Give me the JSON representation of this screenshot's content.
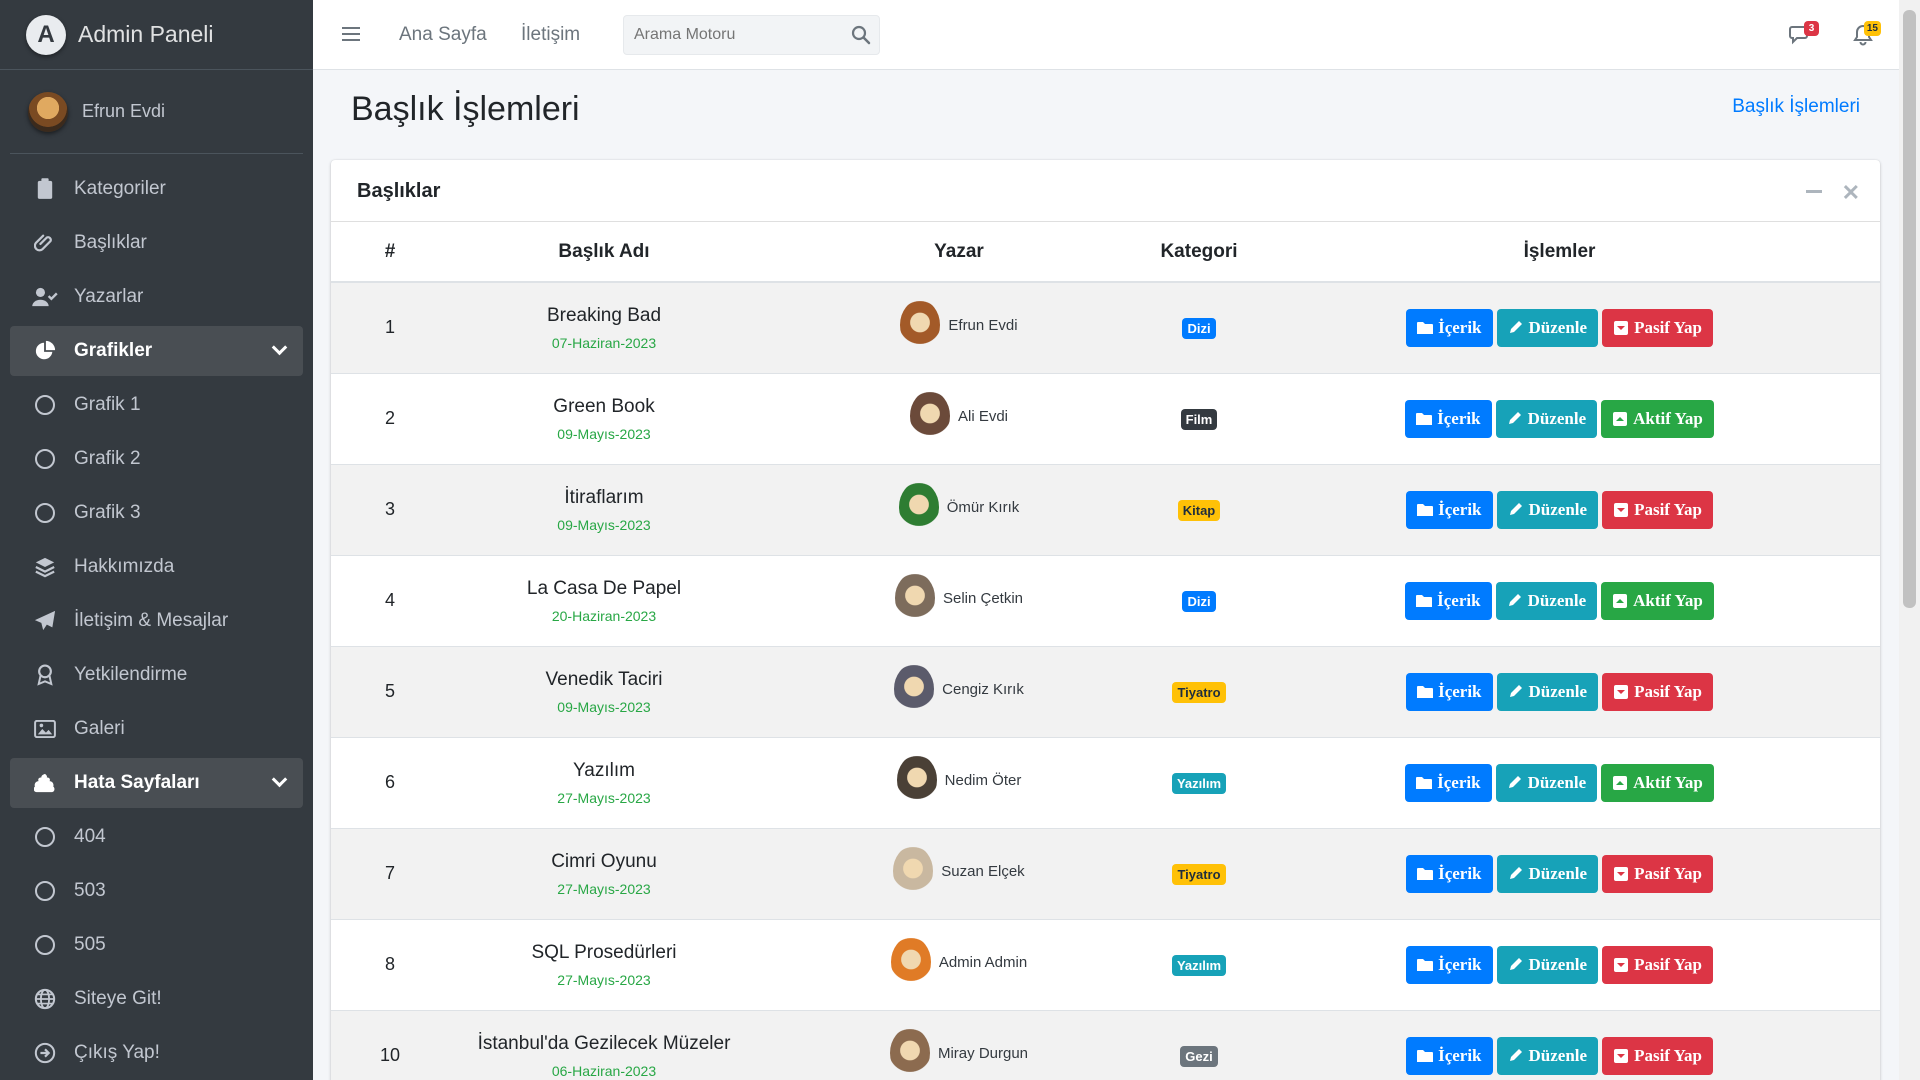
{
  "brand": {
    "title": "Admin Paneli",
    "logo_letter": "A"
  },
  "user": {
    "name": "Efrun Evdi"
  },
  "sidebar": {
    "items": [
      {
        "label": "Kategoriler",
        "icon": "clipboard-icon",
        "open": false
      },
      {
        "label": "Başlıklar",
        "icon": "paperclip-icon",
        "open": false
      },
      {
        "label": "Yazarlar",
        "icon": "user-check-icon",
        "open": false
      },
      {
        "label": "Grafikler",
        "icon": "chart-pie-icon",
        "open": true
      },
      {
        "label": "Grafik 1",
        "icon": "circle-icon",
        "sub": true
      },
      {
        "label": "Grafik 2",
        "icon": "circle-icon",
        "sub": true
      },
      {
        "label": "Grafik 3",
        "icon": "circle-icon",
        "sub": true
      },
      {
        "label": "Hakkımızda",
        "icon": "layers-icon",
        "open": false
      },
      {
        "label": "İletişim & Mesajlar",
        "icon": "paper-plane-icon",
        "open": false
      },
      {
        "label": "Yetkilendirme",
        "icon": "award-icon",
        "open": false
      },
      {
        "label": "Galeri",
        "icon": "image-icon",
        "open": false
      },
      {
        "label": "Hata Sayfaları",
        "icon": "poo-icon",
        "open": true
      },
      {
        "label": "404",
        "icon": "circle-icon",
        "sub": true
      },
      {
        "label": "503",
        "icon": "circle-icon",
        "sub": true
      },
      {
        "label": "505",
        "icon": "circle-icon",
        "sub": true
      },
      {
        "label": "Siteye Git!",
        "icon": "globe-icon",
        "open": false
      },
      {
        "label": "Çıkış Yap!",
        "icon": "sign-out-icon",
        "open": false
      }
    ]
  },
  "topbar": {
    "links": [
      "Ana Sayfa",
      "İletişim"
    ],
    "search_placeholder": "Arama Motoru",
    "messages_count": "3",
    "notifications_count": "15"
  },
  "page": {
    "title": "Başlık İşlemleri",
    "breadcrumb": "Başlık İşlemleri"
  },
  "card": {
    "title": "Başlıklar"
  },
  "table": {
    "headers": [
      "#",
      "Başlık Adı",
      "Yazar",
      "Kategori",
      "İşlemler"
    ],
    "rows": [
      {
        "num": "1",
        "title": "Breaking Bad",
        "date": "07-Haziran-2023",
        "author": "Efrun Evdi",
        "category": "Dizi",
        "status_action": "Pasif Yap"
      },
      {
        "num": "2",
        "title": "Green Book",
        "date": "09-Mayıs-2023",
        "author": "Ali Evdi",
        "category": "Film",
        "status_action": "Aktif Yap"
      },
      {
        "num": "3",
        "title": "İtiraflarım",
        "date": "09-Mayıs-2023",
        "author": "Ömür Kırık",
        "category": "Kitap",
        "status_action": "Pasif Yap"
      },
      {
        "num": "4",
        "title": "La Casa De Papel",
        "date": "20-Haziran-2023",
        "author": "Selin Çetkin",
        "category": "Dizi",
        "status_action": "Aktif Yap"
      },
      {
        "num": "5",
        "title": "Venedik Taciri",
        "date": "09-Mayıs-2023",
        "author": "Cengiz Kırık",
        "category": "Tiyatro",
        "status_action": "Pasif Yap"
      },
      {
        "num": "6",
        "title": "Yazılım",
        "date": "27-Mayıs-2023",
        "author": "Nedim Öter",
        "category": "Yazılım",
        "status_action": "Aktif Yap"
      },
      {
        "num": "7",
        "title": "Cimri Oyunu",
        "date": "27-Mayıs-2023",
        "author": "Suzan Elçek",
        "category": "Tiyatro",
        "status_action": "Pasif Yap"
      },
      {
        "num": "8",
        "title": "SQL Prosedürleri",
        "date": "27-Mayıs-2023",
        "author": "Admin Admin",
        "category": "Yazılım",
        "status_action": "Pasif Yap"
      },
      {
        "num": "10",
        "title": "İstanbul'da Gezilecek Müzeler",
        "date": "06-Haziran-2023",
        "author": "Miray Durgun",
        "category": "Gezi",
        "status_action": "Pasif Yap"
      }
    ],
    "content_label": "İçerik",
    "edit_label": "Düzenle"
  },
  "colors": {
    "Dizi": {
      "bg": "#007bff",
      "fg": "#ffffff"
    },
    "Film": {
      "bg": "#343a40",
      "fg": "#ffffff"
    },
    "Kitap": {
      "bg": "#ffc107",
      "fg": "#1f2d3d"
    },
    "Tiyatro": {
      "bg": "#ffc107",
      "fg": "#1f2d3d"
    },
    "Yazılım": {
      "bg": "#17a2b8",
      "fg": "#ffffff"
    },
    "Gezi": {
      "bg": "#6c757d",
      "fg": "#ffffff"
    }
  }
}
